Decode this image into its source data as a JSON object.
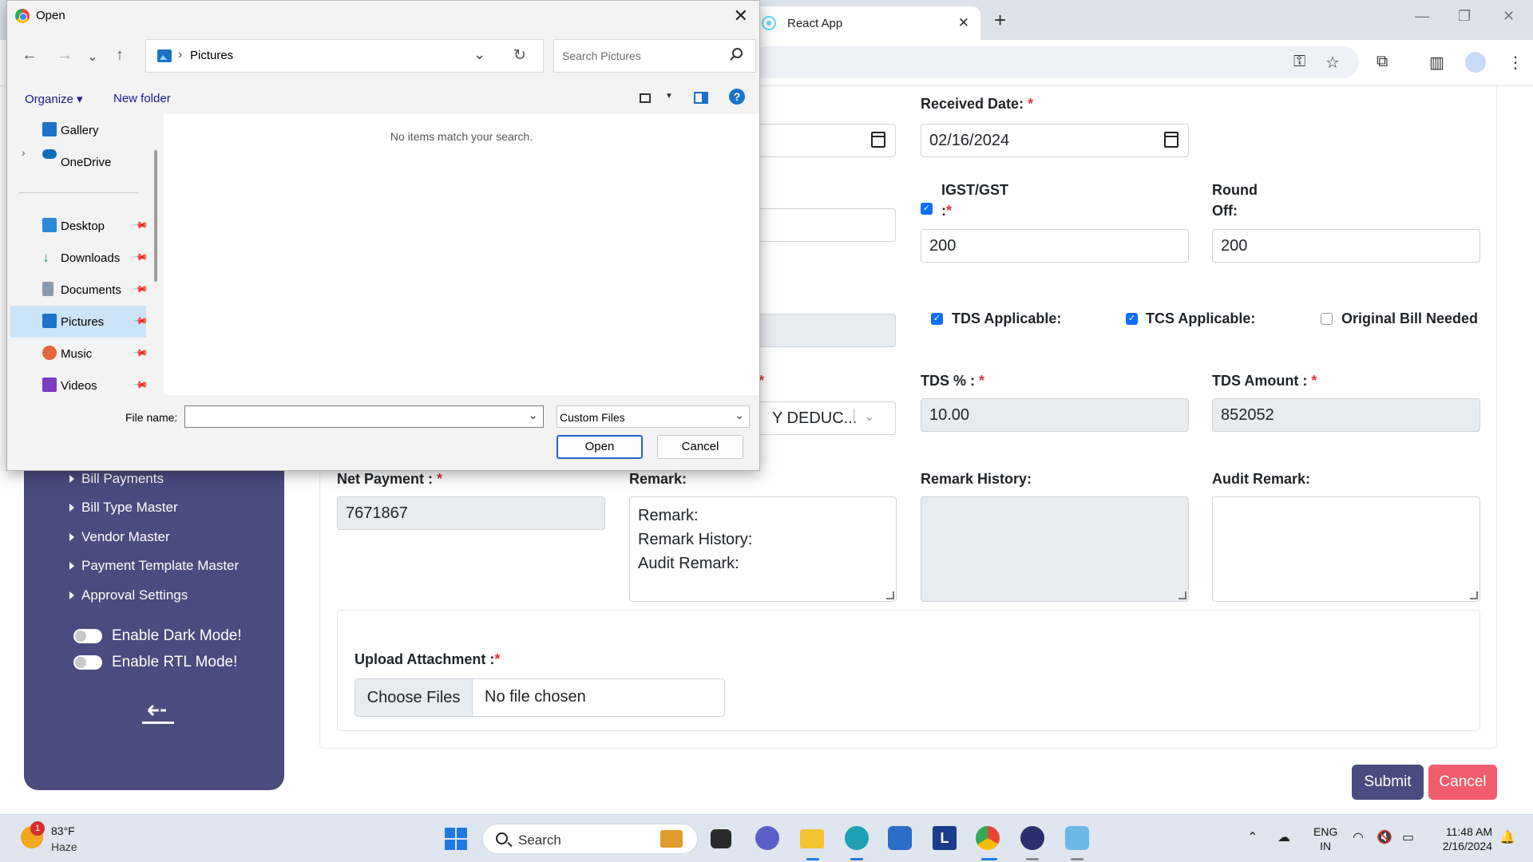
{
  "browser": {
    "tab_title": "React App",
    "tab_close": "✕",
    "new_tab": "+",
    "minimize": "—",
    "restore": "❐",
    "close": "✕"
  },
  "form": {
    "received_date_label": "Received Date:",
    "received_date_value": "02/16/2024",
    "igst_label": "IGST/GST",
    "igst_suffix": ":",
    "igst_value": "200",
    "round_off_label_1": "Round",
    "round_off_label_2": "Off:",
    "round_off_value": "200",
    "tds_applicable_label": "TDS Applicable:",
    "tcs_applicable_label": "TCS Applicable:",
    "original_bill_label": "Original Bill Needed",
    "tds_applicable_checked": true,
    "tcs_applicable_checked": true,
    "original_bill_checked": false,
    "igst_checked": true,
    "section_select_value": "Y DEDUC...",
    "tds_percent_label": "TDS % :",
    "tds_percent_value": "10.00",
    "tds_amount_label": "TDS Amount :",
    "tds_amount_value": "852052",
    "net_payment_label": "Net Payment :",
    "net_payment_value": "7671867",
    "remark_label": "Remark:",
    "remark_lines": [
      "Remark:",
      "Remark History:",
      "Audit Remark:"
    ],
    "remark_history_label": "Remark History:",
    "audit_remark_label": "Audit Remark:",
    "upload_label": "Upload Attachment :",
    "choose_files": "Choose Files",
    "no_file": "No file chosen",
    "submit": "Submit",
    "cancel": "Cancel",
    "required_mark": "*",
    "colors": {
      "submit": "#4a4b7e",
      "cancel": "#f25c6c",
      "required": "#dc3545"
    }
  },
  "sidebar": {
    "items": [
      "Bill Payments",
      "Bill Type Master",
      "Vendor Master",
      "Payment Template Master",
      "Approval Settings"
    ],
    "toggles": [
      "Enable Dark Mode!",
      "Enable RTL Mode!"
    ],
    "collapse_icon": "collapse-arrow-icon",
    "color": "#4a4b7e"
  },
  "dialog": {
    "title": "Open",
    "path": "Pictures",
    "search_placeholder": "Search Pictures",
    "organize": "Organize",
    "new_folder": "New folder",
    "empty_message": "No items match your search.",
    "nav_items": [
      {
        "label": "Gallery",
        "icon": "gallery-icon",
        "color": "#1a73c8"
      },
      {
        "label": "OneDrive",
        "icon": "onedrive-icon",
        "color": "#0f6cbd"
      },
      {
        "label": "Desktop",
        "icon": "desktop-icon",
        "color": "#2b88d8"
      },
      {
        "label": "Downloads",
        "icon": "downloads-icon",
        "color": "#1f9c5a"
      },
      {
        "label": "Documents",
        "icon": "documents-icon",
        "color": "#8a9bb0"
      },
      {
        "label": "Pictures",
        "icon": "pictures-icon",
        "color": "#1a73c8"
      },
      {
        "label": "Music",
        "icon": "music-icon",
        "color": "#e2683c"
      },
      {
        "label": "Videos",
        "icon": "videos-icon",
        "color": "#7a3cc2"
      }
    ],
    "file_name_label": "File name:",
    "file_name_value": "",
    "filter_value": "Custom Files",
    "open_button": "Open",
    "cancel_button": "Cancel"
  },
  "taskbar": {
    "weather_badge": "1",
    "temperature": "83°F",
    "condition": "Haze",
    "search_label": "Search",
    "lang_1": "ENG",
    "lang_2": "IN",
    "time": "11:48 AM",
    "date": "2/16/2024"
  }
}
